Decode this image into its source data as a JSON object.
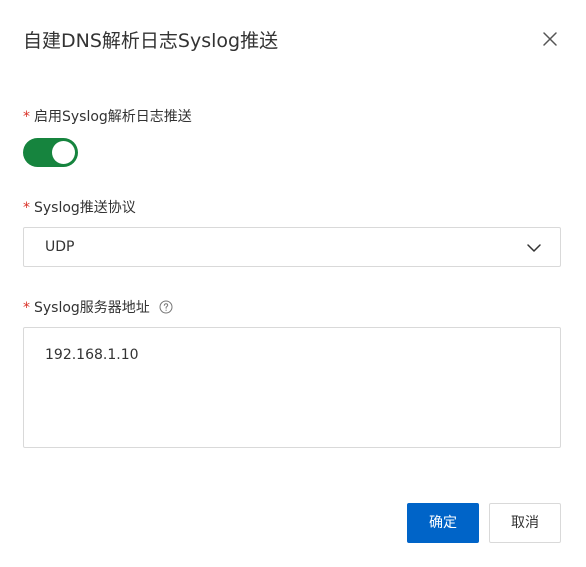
{
  "dialog": {
    "title": "自建DNS解析日志Syslog推送"
  },
  "fields": {
    "enable": {
      "required_mark": "*",
      "label": "启用Syslog解析日志推送",
      "enabled": true,
      "accent_color": "#16843e"
    },
    "protocol": {
      "required_mark": "*",
      "label": "Syslog推送协议",
      "value": "UDP"
    },
    "server": {
      "required_mark": "*",
      "label": "Syslog服务器地址",
      "value": "192.168.1.10"
    }
  },
  "footer": {
    "confirm_label": "确定",
    "cancel_label": "取消",
    "primary_color": "#0064c8"
  },
  "icons": {
    "close": "close-icon",
    "help": "question-circle-icon",
    "dropdown": "chevron-down-icon"
  }
}
